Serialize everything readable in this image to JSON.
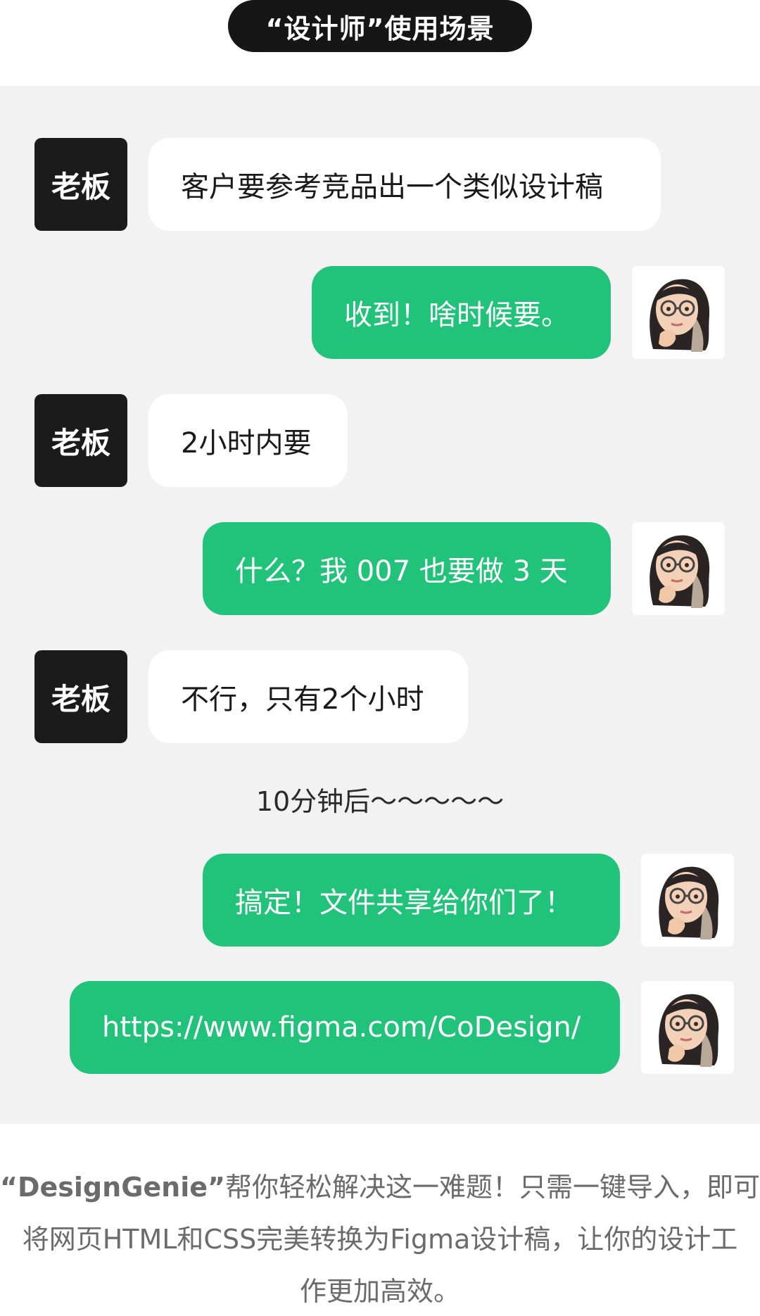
{
  "header": {
    "title": "“设计师”使用场景"
  },
  "boss_label": "老板",
  "messages": [
    {
      "from": "boss",
      "text": "客户要参考竞品出一个类似设计稿"
    },
    {
      "from": "me",
      "text": "收到！啥时候要。"
    },
    {
      "from": "boss",
      "text": "2小时内要"
    },
    {
      "from": "me",
      "text": "什么？我 007 也要做 3 天"
    },
    {
      "from": "boss",
      "text": "不行，只有2个小时"
    },
    {
      "from": "me",
      "text": "搞定！文件共享给你们了！"
    },
    {
      "from": "me",
      "text": "https://www.figma.com/CoDesign/"
    }
  ],
  "time_divider": "10分钟后～～～～～",
  "footer": {
    "brand": "“DesignGenie”",
    "line1_rest": "帮你轻松解决这一难题！只需一键导入，即可",
    "line2": "将网页HTML和CSS完美转换为Figma设计稿，让你的设计工",
    "line3": "作更加高效。"
  },
  "colors": {
    "accent_green": "#21c27a",
    "pill_bg": "#161616",
    "chat_bg": "#f2f2f2"
  }
}
